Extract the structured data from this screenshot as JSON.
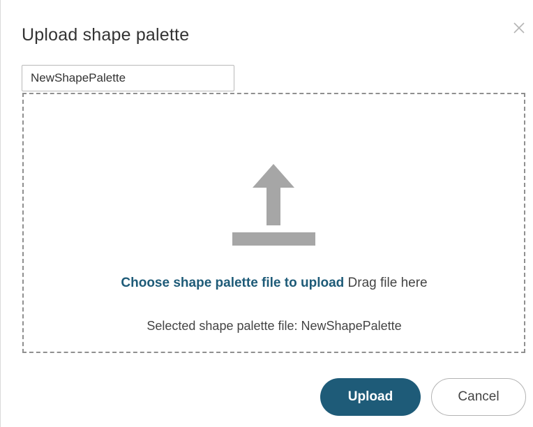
{
  "dialog": {
    "title": "Upload shape palette",
    "close_icon": "close-icon"
  },
  "name_input": {
    "value": "NewShapePalette"
  },
  "dropzone": {
    "icon": "upload-arrow-icon",
    "choose_link": "Choose shape palette file to upload",
    "drag_text": "Drag file here",
    "selected_text": "Selected shape palette file: NewShapePalette"
  },
  "buttons": {
    "upload_label": "Upload",
    "cancel_label": "Cancel"
  },
  "colors": {
    "primary": "#1e5b78",
    "icon_gray": "#a6a6a6",
    "dashed_border": "#8f8f8f"
  }
}
